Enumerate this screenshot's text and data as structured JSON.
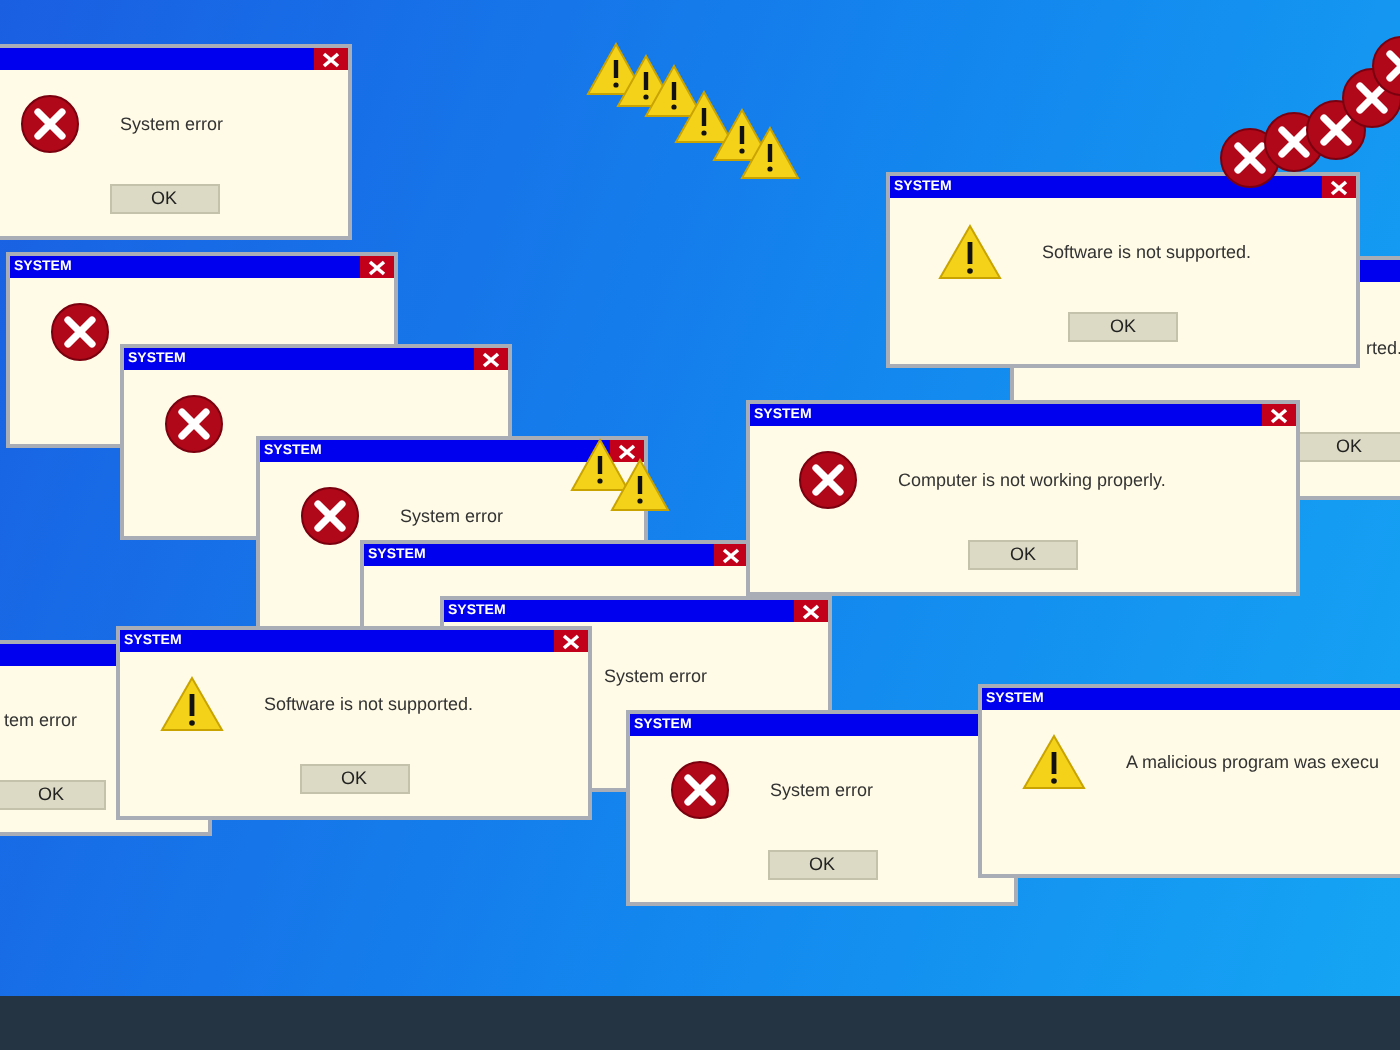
{
  "windows": [
    {
      "kind": "error",
      "message": "System error",
      "button": "OK"
    },
    {
      "title": "SYSTEM",
      "kind": "error"
    },
    {
      "title": "SYSTEM",
      "kind": "error"
    },
    {
      "title": "SYSTEM",
      "kind": "error",
      "message": "System error"
    },
    {
      "title": "SYSTEM"
    },
    {
      "title": "SYSTEM",
      "message": "System error"
    },
    {
      "message": "tem error",
      "button": "OK"
    },
    {
      "title": "SYSTEM",
      "kind": "warning",
      "message": "Software is not supported.",
      "button": "OK"
    },
    {
      "title": "SYSTEM",
      "kind": "error",
      "message": "System error",
      "button": "OK"
    },
    {
      "message": "rted.",
      "button": "OK"
    },
    {
      "title": "SYSTEM",
      "kind": "warning",
      "message": "A malicious program was execu"
    },
    {
      "title": "SYSTEM",
      "kind": "warning",
      "message": "Software is not supported.",
      "button": "OK"
    },
    {
      "title": "SYSTEM",
      "kind": "error",
      "message": "Computer is not working properly.",
      "button": "OK"
    }
  ]
}
